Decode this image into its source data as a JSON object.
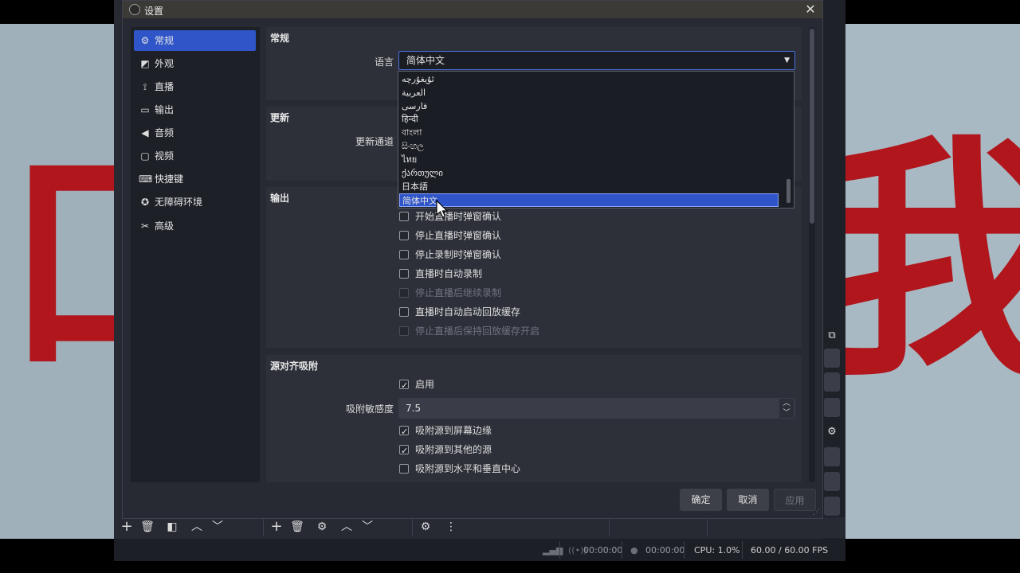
{
  "dialog": {
    "title": "设置",
    "close_glyph": "✕"
  },
  "sidebar": {
    "items": [
      {
        "label": "常规",
        "icon": "gear-icon",
        "glyph": "⚙"
      },
      {
        "label": "外观",
        "icon": "appearance-icon",
        "glyph": "◩"
      },
      {
        "label": "直播",
        "icon": "antenna-icon",
        "glyph": "⟟"
      },
      {
        "label": "输出",
        "icon": "output-icon",
        "glyph": "▭"
      },
      {
        "label": "音频",
        "icon": "speaker-icon",
        "glyph": "◀"
      },
      {
        "label": "视频",
        "icon": "monitor-icon",
        "glyph": "▢"
      },
      {
        "label": "快捷键",
        "icon": "keyboard-icon",
        "glyph": "⌨"
      },
      {
        "label": "无障碍环境",
        "icon": "accessibility-icon",
        "glyph": "✪"
      },
      {
        "label": "高级",
        "icon": "tools-icon",
        "glyph": "✂"
      }
    ]
  },
  "general": {
    "section_title": "常规",
    "language_label": "语言",
    "language_value": "简体中文",
    "language_options": [
      "ئۇيغۇرچە",
      "العربية",
      "فارسی",
      "हिन्दी",
      "বাংলা",
      "සිංහල",
      "ไทย",
      "ქართული",
      "日本語",
      "简体中文"
    ],
    "selected_index": 9
  },
  "update": {
    "section_title": "更新",
    "channel_label": "更新通道"
  },
  "output": {
    "section_title": "输出",
    "checks": [
      {
        "label": "开始直播时弹窗确认",
        "checked": false,
        "disabled": false
      },
      {
        "label": "停止直播时弹窗确认",
        "checked": false,
        "disabled": false
      },
      {
        "label": "停止录制时弹窗确认",
        "checked": false,
        "disabled": false
      },
      {
        "label": "直播时自动录制",
        "checked": false,
        "disabled": false
      },
      {
        "label": "停止直播后继续录制",
        "checked": false,
        "disabled": true
      },
      {
        "label": "直播时自动启动回放缓存",
        "checked": false,
        "disabled": false
      },
      {
        "label": "停止直播后保持回放缓存开启",
        "checked": false,
        "disabled": true
      }
    ]
  },
  "snapping": {
    "section_title": "源对齐吸附",
    "enable_label": "启用",
    "enable_checked": true,
    "sensitivity_label": "吸附敏感度",
    "sensitivity_value": "7.5",
    "checks": [
      {
        "label": "吸附源到屏幕边缘",
        "checked": true
      },
      {
        "label": "吸附源到其他的源",
        "checked": true
      },
      {
        "label": "吸附源到水平和垂直中心",
        "checked": false
      }
    ]
  },
  "buttons": {
    "ok": "确定",
    "cancel": "取消",
    "apply": "应用"
  },
  "status_bar": {
    "stream_time": "00:00:00",
    "record_time": "00:00:00",
    "cpu": "CPU: 1.0%",
    "fps": "60.00 / 60.00 FPS"
  },
  "colors": {
    "accent": "#2f55c8",
    "panel": "#2d3039",
    "background": "#272a33",
    "canvas_text": "#b0161c"
  }
}
